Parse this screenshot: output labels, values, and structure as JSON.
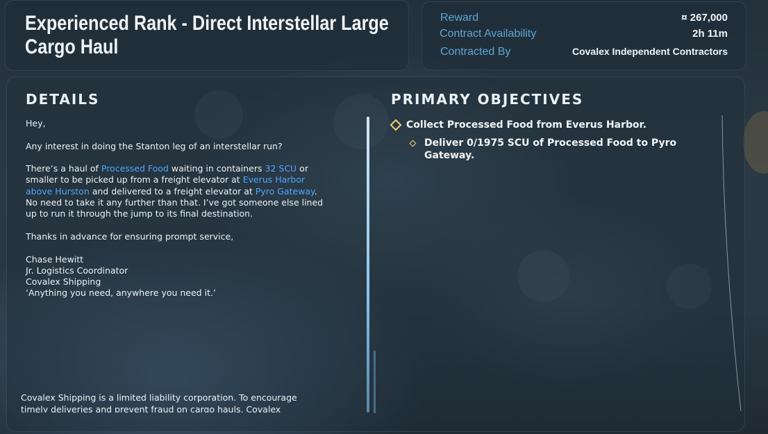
{
  "contract": {
    "title": "Experienced Rank - Direct Interstellar Large Cargo Haul"
  },
  "info": {
    "reward_label": "Reward",
    "reward_value": "¤ 267,000",
    "availability_label": "Contract Availability",
    "availability_value": "2h 11m",
    "contracted_by_label": "Contracted By",
    "contracted_by_value": "Covalex Independent Contractors"
  },
  "details": {
    "heading": "DETAILS",
    "greeting": "Hey,",
    "line1": "Any interest in doing the Stanton leg of an interstellar run?",
    "p2_a": "There’s a haul of ",
    "p2_cargo": "Processed Food",
    "p2_b": " waiting in containers ",
    "p2_size": "32 SCU",
    "p2_c": " or smaller to be picked up from a freight elevator at ",
    "p2_pickup": "Everus Harbor above Hurston",
    "p2_d": " and delivered to a freight elevator at ",
    "p2_dest": "Pyro Gateway",
    "p2_e": ". No need to take it any further than that. I’ve got someone else lined up to run it through the jump to its final destination.",
    "thanks": "Thanks in advance for ensuring prompt service,",
    "sig_name": "Chase Hewitt",
    "sig_title": "Jr. Logistics Coordinator",
    "sig_company": "Covalex Shipping",
    "sig_motto": "‘Anything you need, anywhere you need it.’",
    "footer": "Covalex Shipping is a limited liability corporation. To encourage timely deliveries and prevent fraud on cargo hauls, Covalex"
  },
  "objectives": {
    "heading": "PRIMARY OBJECTIVES",
    "primary": "Collect Processed Food from Everus Harbor.",
    "sub": "Deliver 0/1975 SCU of Processed Food to Pyro Gateway."
  },
  "colors": {
    "highlight": "#4fa6ff",
    "label": "#5fa6d6",
    "diamond": "#f0d27a"
  }
}
